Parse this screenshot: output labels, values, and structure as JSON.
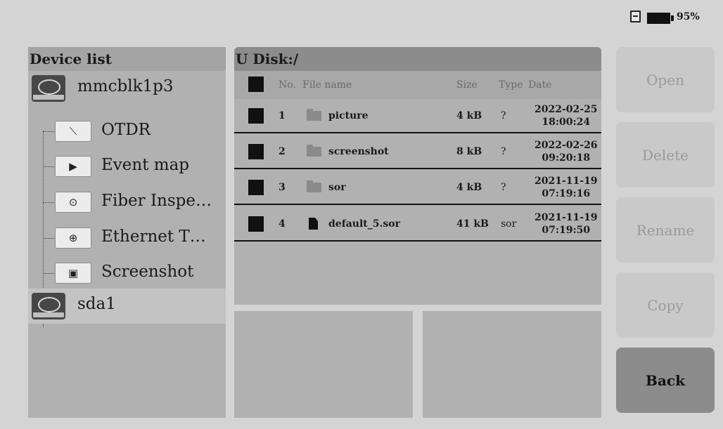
{
  "status": {
    "battery_percent": "95%",
    "sd_icon": "sd-card-icon",
    "battery_icon": "battery-icon"
  },
  "device_list": {
    "title": "Device list",
    "devices": [
      {
        "label": "mmcblk1p3",
        "icon": "disk-icon"
      },
      {
        "label": "sda1",
        "icon": "disk-icon"
      }
    ],
    "tree": [
      {
        "label": "OTDR",
        "icon": "otdr-icon",
        "glyph": "⟍"
      },
      {
        "label": "Event map",
        "icon": "event-map-icon",
        "glyph": "▶"
      },
      {
        "label": "Fiber Inspe…",
        "icon": "fiber-inspect-icon",
        "glyph": "⊙"
      },
      {
        "label": "Ethernet T…",
        "icon": "ethernet-icon",
        "glyph": "⊕"
      },
      {
        "label": "Screenshot",
        "icon": "screenshot-icon",
        "glyph": "▣"
      }
    ]
  },
  "file_panel": {
    "path": "U Disk:/",
    "columns": {
      "no": "No.",
      "name": "File name",
      "size": "Size",
      "type": "Type",
      "date": "Date"
    },
    "files": [
      {
        "no": "1",
        "name": "picture",
        "size": "4 kB",
        "type": "?",
        "date": "2022-02-25",
        "time": "18:00:24",
        "kind": "folder"
      },
      {
        "no": "2",
        "name": "screenshot",
        "size": "8 kB",
        "type": "?",
        "date": "2022-02-26",
        "time": "09:20:18",
        "kind": "folder"
      },
      {
        "no": "3",
        "name": "sor",
        "size": "4 kB",
        "type": "?",
        "date": "2021-11-19",
        "time": "07:19:16",
        "kind": "folder"
      },
      {
        "no": "4",
        "name": "default_5.sor",
        "size": "41 kB",
        "type": "sor",
        "date": "2021-11-19",
        "time": "07:19:50",
        "kind": "file"
      }
    ]
  },
  "actions": {
    "open": "Open",
    "delete": "Delete",
    "rename": "Rename",
    "copy": "Copy",
    "back": "Back"
  }
}
